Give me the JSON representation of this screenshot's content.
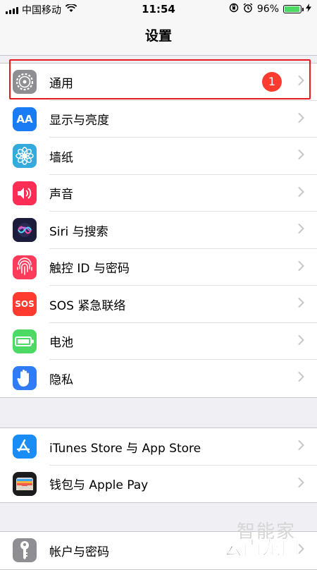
{
  "status": {
    "carrier": "中国移动",
    "time": "11:54",
    "battery_text": "96%",
    "battery_level": 0.96
  },
  "nav": {
    "title": "设置"
  },
  "group1": [
    {
      "label": "通用",
      "icon": "gear-icon",
      "color": "#8e8e93",
      "badge": "1"
    },
    {
      "label": "显示与亮度",
      "icon": "display-brightness-icon",
      "color": "#1a7cf5",
      "icon_text": "AA"
    },
    {
      "label": "墙纸",
      "icon": "wallpaper-flower-icon",
      "color": "#35aadc"
    },
    {
      "label": "声音",
      "icon": "speaker-icon",
      "color": "#ff2d55"
    },
    {
      "label": "Siri 与搜索",
      "icon": "siri-icon",
      "color": "#1c1c3c"
    },
    {
      "label": "触控 ID 与密码",
      "icon": "fingerprint-icon",
      "color": "#ff3b5c"
    },
    {
      "label": "SOS 紧急联络",
      "icon": "sos-icon",
      "color": "#ff3b30",
      "icon_text": "SOS"
    },
    {
      "label": "电池",
      "icon": "battery-icon",
      "color": "#4cd964"
    },
    {
      "label": "隐私",
      "icon": "hand-icon",
      "color": "#2f7cf6"
    }
  ],
  "group2": [
    {
      "label": "iTunes Store 与 App Store",
      "icon": "app-store-icon",
      "color": "#1a8cf5"
    },
    {
      "label": "钱包与 Apple Pay",
      "icon": "wallet-icon",
      "color": "#1c1c1e"
    }
  ],
  "group3": [
    {
      "label": "帐户与密码",
      "icon": "key-icon",
      "color": "#8e8e93"
    }
  ],
  "watermark": {
    "line1": "智能家",
    "line2": "云南龙网"
  }
}
